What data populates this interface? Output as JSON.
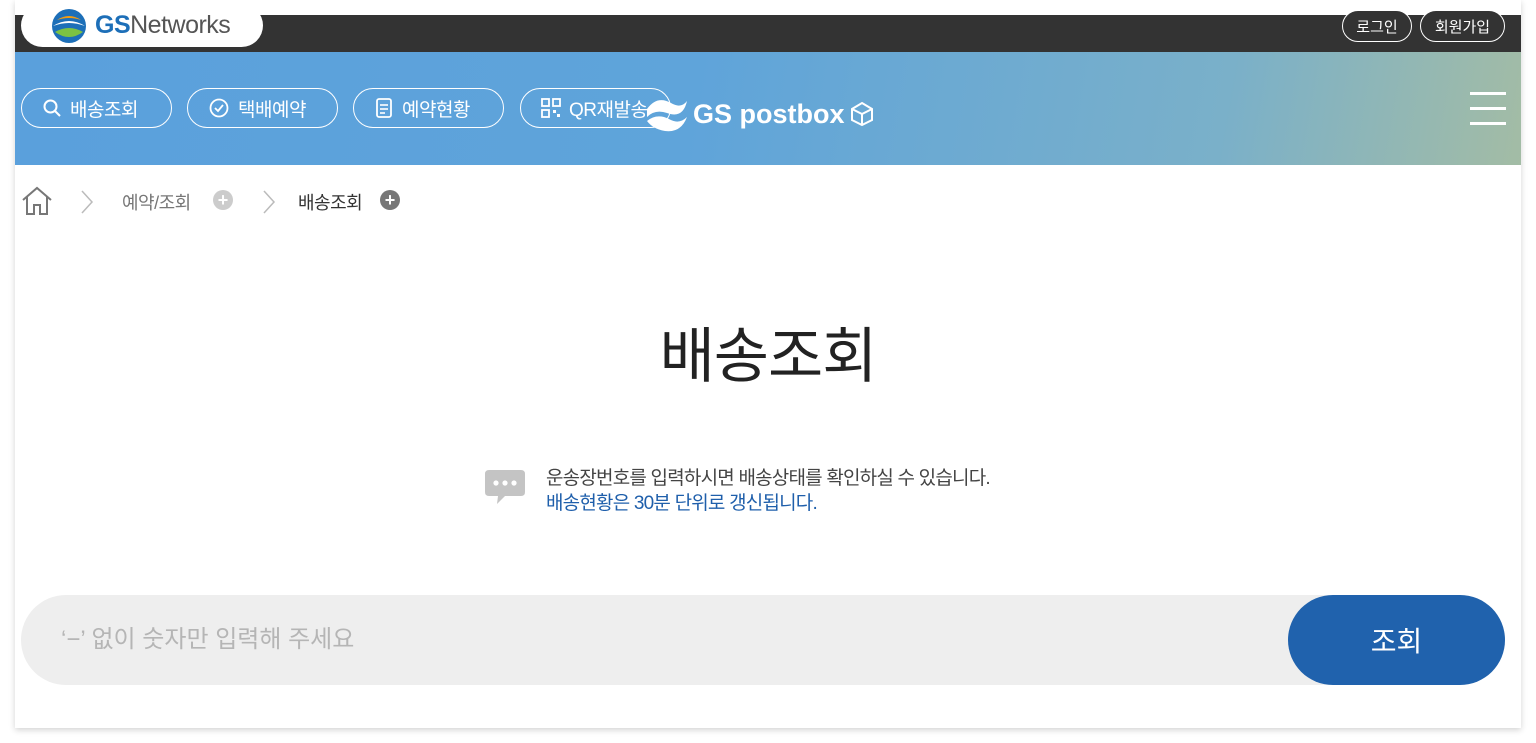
{
  "header": {
    "brand_bold": "GS",
    "brand_rest": "Networks",
    "login_label": "로그인",
    "join_label": "회원가입"
  },
  "nav": {
    "items": [
      {
        "label": "배송조회",
        "icon": "search-icon"
      },
      {
        "label": "택배예약",
        "icon": "clock-icon"
      },
      {
        "label": "예약현황",
        "icon": "document-icon"
      },
      {
        "label": "QR재발송",
        "icon": "qr-icon"
      }
    ],
    "logo_text": "GS postbox",
    "menu_icon": "hamburger-icon"
  },
  "breadcrumb": {
    "home_icon": "home-icon",
    "items": [
      "예약/조회",
      "배송조회"
    ]
  },
  "main": {
    "title": "배송조회",
    "notice_line1": "운송장번호를 입력하시면 배송상태를 확인하실 수 있습니다.",
    "notice_line2": "배송현황은 30분 단위로 갱신됩니다.",
    "notice_icon": "speech-bubble-icon"
  },
  "search": {
    "placeholder": "‘−’ 없이 숫자만 입력해 주세요",
    "value": "",
    "button_label": "조회"
  },
  "colors": {
    "topbar": "#333333",
    "nav_gradient_start": "#5aa0dc",
    "nav_gradient_end": "#a3bca5",
    "accent": "#2062ad",
    "notice_highlight": "#1f5fab"
  }
}
